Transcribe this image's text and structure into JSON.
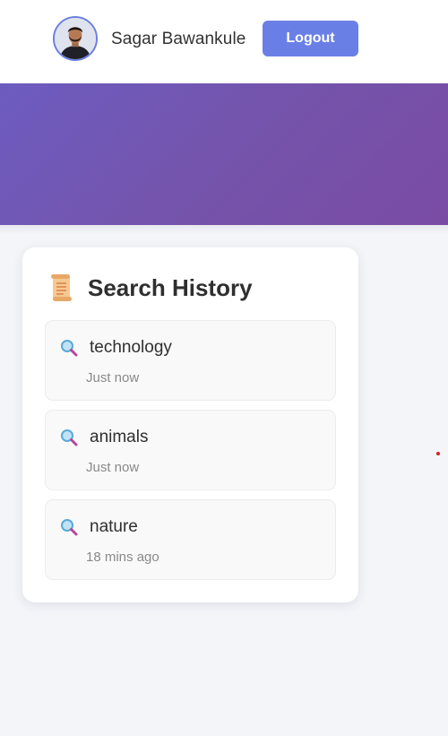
{
  "header": {
    "user_name": "Sagar Bawankule",
    "logout_label": "Logout"
  },
  "history": {
    "title": "Search History",
    "title_icon": "scroll-icon",
    "items": [
      {
        "query": "technology",
        "time": "Just now",
        "icon": "magnifier-icon"
      },
      {
        "query": "animals",
        "time": "Just now",
        "icon": "magnifier-icon"
      },
      {
        "query": "nature",
        "time": "18 mins ago",
        "icon": "magnifier-icon"
      }
    ]
  },
  "colors": {
    "accent": "#6a7fe6",
    "hero_start": "#6d5cc0",
    "hero_end": "#7a4ba4",
    "background": "#f4f5f9"
  }
}
